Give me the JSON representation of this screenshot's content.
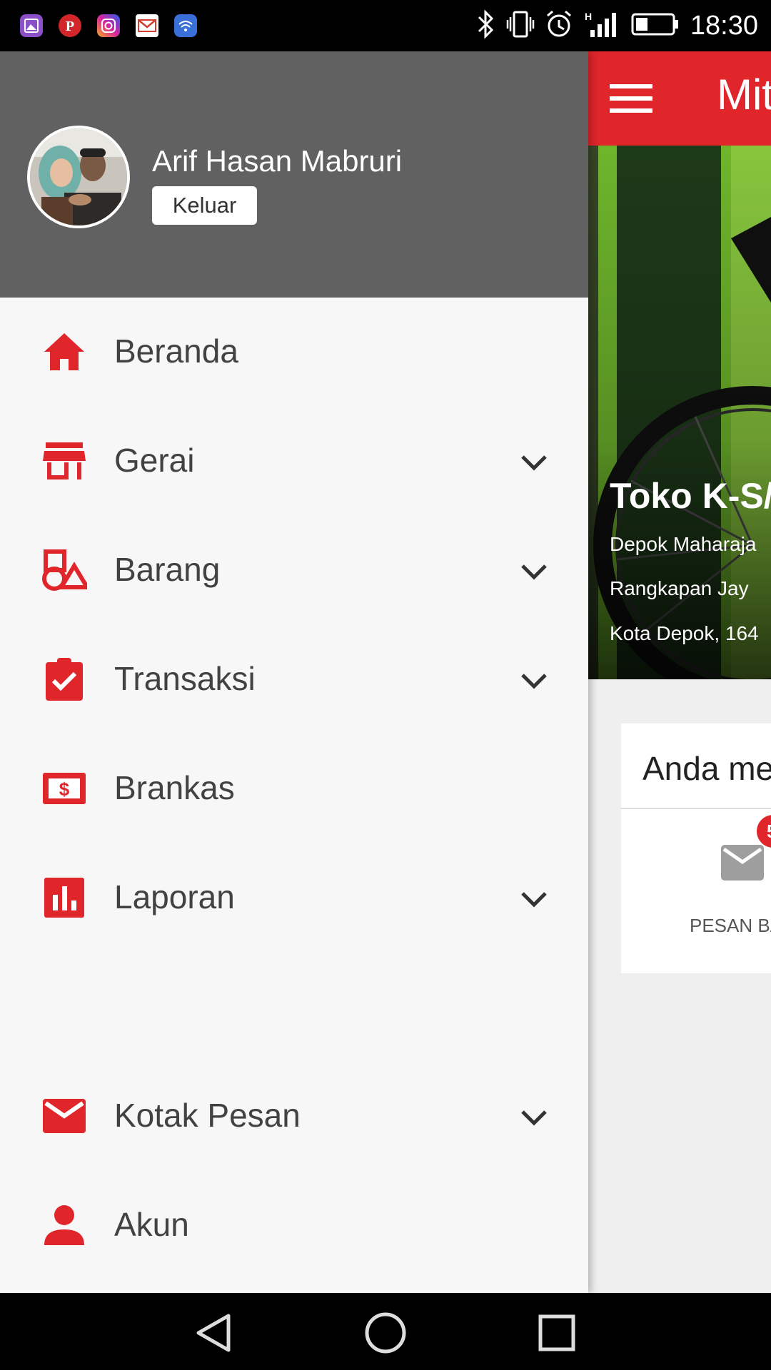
{
  "status_bar": {
    "time": "18:30",
    "notification_icons": [
      "gallery-icon",
      "pinterest-icon",
      "instagram-icon",
      "gmail-icon",
      "wifi-share-icon"
    ],
    "system_icons": [
      "bluetooth-icon",
      "vibrate-icon",
      "alarm-icon",
      "signal-h-icon",
      "battery-icon"
    ]
  },
  "drawer": {
    "user": {
      "name": "Arif Hasan Mabruri",
      "logout_label": "Keluar"
    },
    "items": [
      {
        "label": "Beranda",
        "icon": "home-icon",
        "expandable": false
      },
      {
        "label": "Gerai",
        "icon": "store-icon",
        "expandable": true
      },
      {
        "label": "Barang",
        "icon": "shapes-icon",
        "expandable": true
      },
      {
        "label": "Transaksi",
        "icon": "clipboard-check-icon",
        "expandable": true
      },
      {
        "label": "Brankas",
        "icon": "money-icon",
        "expandable": false
      },
      {
        "label": "Laporan",
        "icon": "bar-chart-icon",
        "expandable": true
      },
      {
        "label": "Kotak Pesan",
        "icon": "mail-icon",
        "expandable": true
      },
      {
        "label": "Akun",
        "icon": "person-icon",
        "expandable": false
      }
    ]
  },
  "background_app": {
    "toolbar_title": "Mit",
    "store_name": "Toko K-S/",
    "address_lines": [
      "Depok Maharaja",
      "Rangkapan Jay",
      "Kota Depok, 164"
    ],
    "card_title": "Anda me",
    "card_badge": "5",
    "card_item_label": "PESAN BA"
  },
  "colors": {
    "accent": "#e0262b",
    "drawer_header": "#616161",
    "drawer_bg": "#f7f7f7",
    "menu_text": "#424242"
  }
}
